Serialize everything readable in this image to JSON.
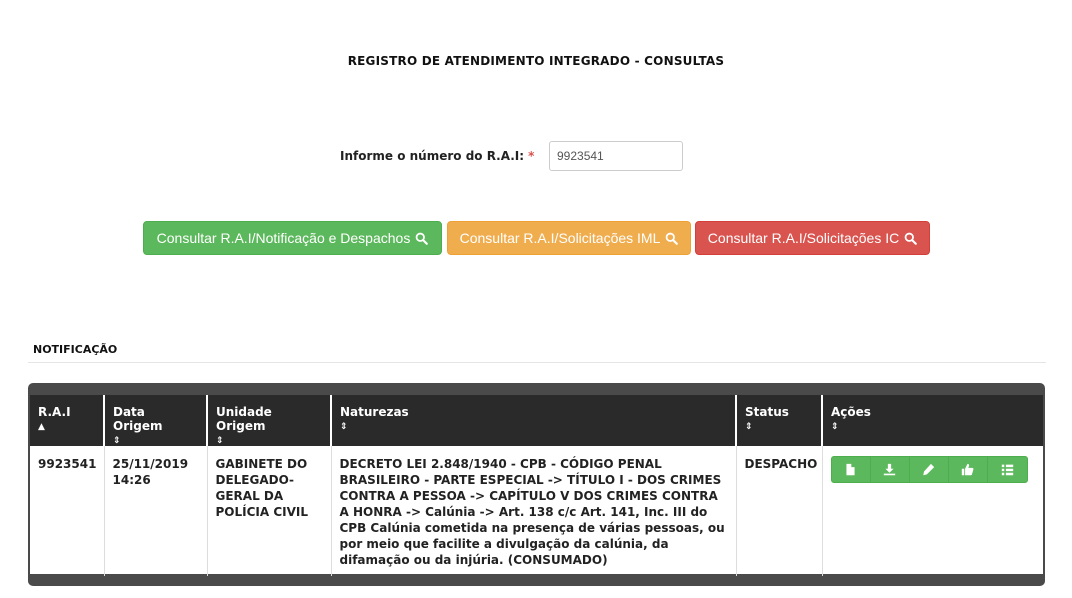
{
  "header": {
    "title": "REGISTRO DE ATENDIMENTO INTEGRADO - CONSULTAS"
  },
  "form": {
    "rai_label": "Informe o número do R.A.I:",
    "required_mark": "*",
    "rai_value": "9923541"
  },
  "buttons": {
    "notificacao": "Consultar R.A.I/Notificação e Despachos",
    "iml": "Consultar R.A.I/Solicitações IML",
    "ic": "Consultar R.A.I/Solicitações IC"
  },
  "colors": {
    "success": "#5cb85c",
    "warning": "#f0ad4e",
    "danger": "#d9534f",
    "table_header": "#2a2a2a"
  },
  "section": {
    "title": "NOTIFICAÇÃO"
  },
  "table": {
    "columns": [
      {
        "label": "R.A.I",
        "sort": "▲"
      },
      {
        "label": "Data Origem",
        "sort": "⇕"
      },
      {
        "label": "Unidade Origem",
        "sort": "⇕"
      },
      {
        "label": "Naturezas",
        "sort": "⇕"
      },
      {
        "label": "Status",
        "sort": "⇕"
      },
      {
        "label": "Ações",
        "sort": "⇕"
      }
    ],
    "rows": [
      {
        "rai": "9923541",
        "data_origem": "25/11/2019 14:26",
        "unidade_origem": "GABINETE DO DELEGADO-GERAL DA POLÍCIA CIVIL",
        "naturezas": "DECRETO LEI 2.848/1940 - CPB - CÓDIGO PENAL BRASILEIRO - PARTE ESPECIAL -> TÍTULO I - DOS CRIMES CONTRA A PESSOA -> CAPÍTULO V DOS CRIMES CONTRA A HONRA -> Calúnia -> Art. 138 c/c Art. 141, Inc. III do CPB Calúnia cometida na presença de várias pessoas, ou por meio que facilite a divulgação da calúnia, da difamação ou da injúria. (CONSUMADO)",
        "status": "DESPACHO",
        "actions": [
          "file-icon",
          "download-icon",
          "pencil-icon",
          "thumbs-up-icon",
          "list-icon"
        ]
      }
    ]
  }
}
